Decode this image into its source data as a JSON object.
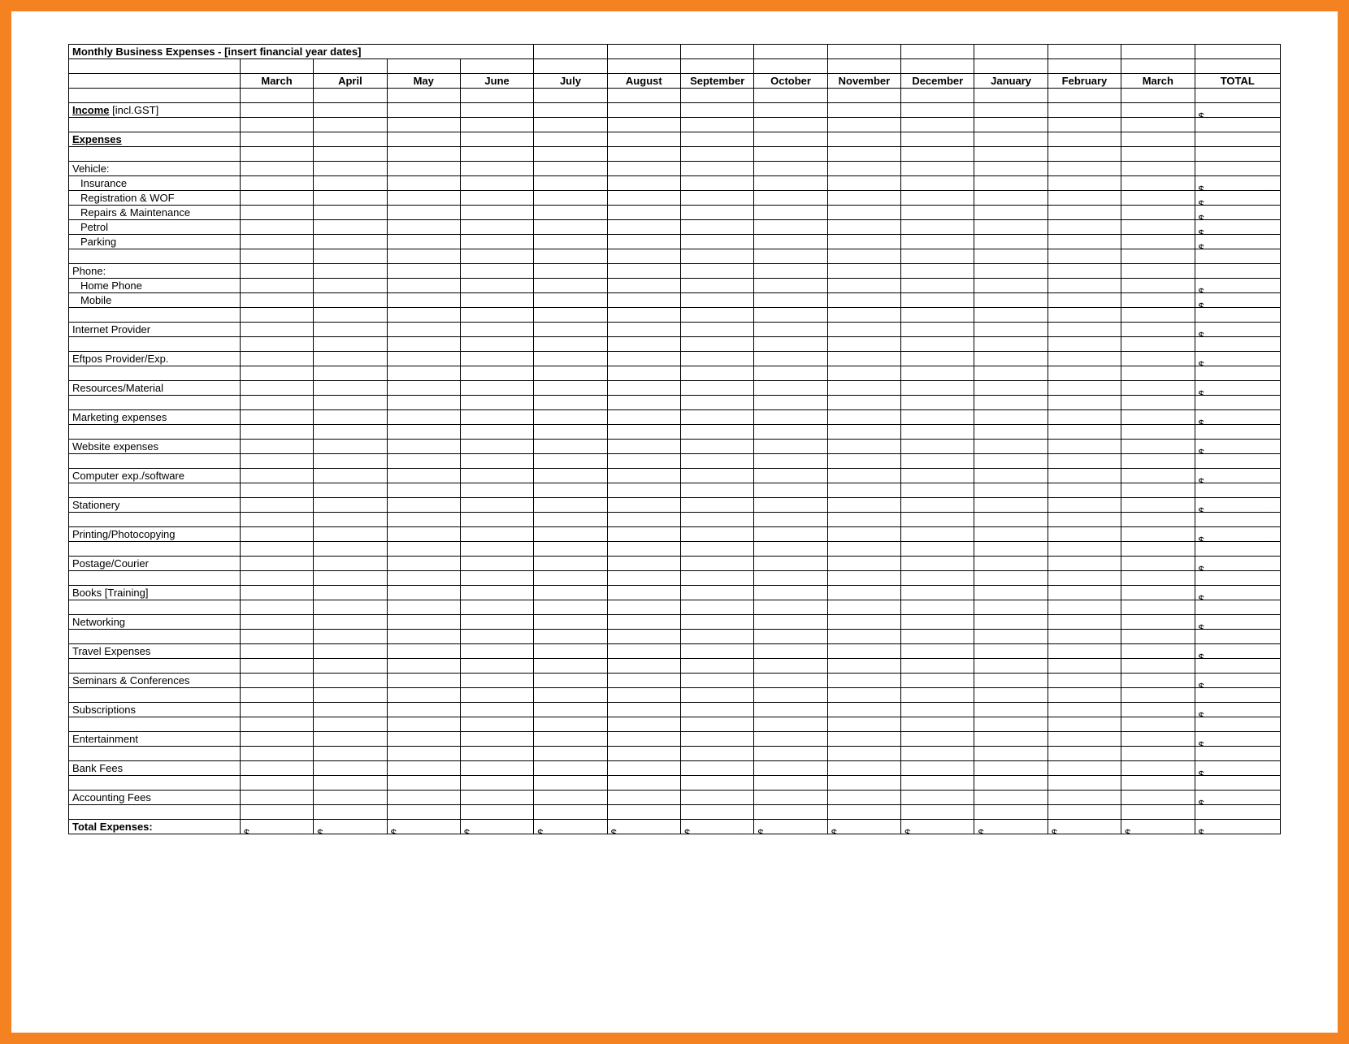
{
  "title": "Monthly Business Expenses - [insert financial year dates]",
  "months": [
    "March",
    "April",
    "May",
    "June",
    "July",
    "August",
    "September",
    "October",
    "November",
    "December",
    "January",
    "February",
    "March"
  ],
  "total_header": "TOTAL",
  "currency": "$",
  "dash": "-",
  "rows": [
    {
      "type": "blank"
    },
    {
      "type": "heading",
      "label": "Income",
      "suffix": " [incl.GST]",
      "underline": true,
      "total_money": true
    },
    {
      "type": "blank"
    },
    {
      "type": "heading",
      "label": "Expenses",
      "underline": true
    },
    {
      "type": "blank"
    },
    {
      "type": "section",
      "label": "Vehicle:"
    },
    {
      "type": "item",
      "label": "Insurance",
      "indent": true,
      "total_money": true
    },
    {
      "type": "item",
      "label": "Registration & WOF",
      "indent": true,
      "total_money": true
    },
    {
      "type": "item",
      "label": "Repairs & Maintenance",
      "indent": true,
      "total_money": true
    },
    {
      "type": "item",
      "label": "Petrol",
      "indent": true,
      "total_money": true
    },
    {
      "type": "item",
      "label": "Parking",
      "indent": true,
      "total_money": true
    },
    {
      "type": "blank"
    },
    {
      "type": "section",
      "label": "Phone:"
    },
    {
      "type": "item",
      "label": "Home Phone",
      "indent": true,
      "total_money": true
    },
    {
      "type": "item",
      "label": "Mobile",
      "indent": true,
      "total_money": true
    },
    {
      "type": "blank"
    },
    {
      "type": "item",
      "label": "Internet Provider",
      "total_money": true
    },
    {
      "type": "blank"
    },
    {
      "type": "item",
      "label": "Eftpos Provider/Exp.",
      "total_money": true
    },
    {
      "type": "blank"
    },
    {
      "type": "item",
      "label": "Resources/Material",
      "total_money": true
    },
    {
      "type": "blank"
    },
    {
      "type": "item",
      "label": "Marketing expenses",
      "total_money": true
    },
    {
      "type": "blank"
    },
    {
      "type": "item",
      "label": "Website expenses",
      "total_money": true
    },
    {
      "type": "blank"
    },
    {
      "type": "item",
      "label": "Computer exp./software",
      "total_money": true
    },
    {
      "type": "blank"
    },
    {
      "type": "item",
      "label": "Stationery",
      "total_money": true
    },
    {
      "type": "blank"
    },
    {
      "type": "item",
      "label": "Printing/Photocopying",
      "total_money": true
    },
    {
      "type": "blank"
    },
    {
      "type": "item",
      "label": "Postage/Courier",
      "total_money": true
    },
    {
      "type": "blank"
    },
    {
      "type": "item",
      "label": "Books [Training]",
      "total_money": true
    },
    {
      "type": "blank"
    },
    {
      "type": "item",
      "label": "Networking",
      "total_money": true
    },
    {
      "type": "blank"
    },
    {
      "type": "item",
      "label": "Travel Expenses",
      "total_money": true
    },
    {
      "type": "blank"
    },
    {
      "type": "item",
      "label": "Seminars & Conferences",
      "total_money": true
    },
    {
      "type": "blank"
    },
    {
      "type": "item",
      "label": "Subscriptions",
      "total_money": true
    },
    {
      "type": "blank"
    },
    {
      "type": "item",
      "label": "Entertainment",
      "total_money": true
    },
    {
      "type": "blank"
    },
    {
      "type": "item",
      "label": "Bank Fees",
      "total_money": true
    },
    {
      "type": "blank"
    },
    {
      "type": "item",
      "label": "Accounting Fees",
      "total_money": true
    },
    {
      "type": "blank"
    },
    {
      "type": "totalrow",
      "label": "Total Expenses:",
      "month_money": true,
      "total_money": true
    }
  ]
}
